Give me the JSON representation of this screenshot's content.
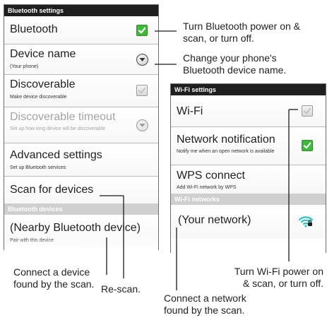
{
  "bluetooth_panel": {
    "header": "Bluetooth settings",
    "items": [
      {
        "title": "Bluetooth",
        "control": "checkbox-checked"
      },
      {
        "title": "Device name",
        "subtitle": "(Your phone)",
        "control": "round-button"
      },
      {
        "title": "Discoverable",
        "subtitle": "Make device discoverable",
        "control": "checkbox-unchecked"
      },
      {
        "title": "Discoverable timeout",
        "subtitle": "Set up how long device will be discoverable",
        "disabled": true,
        "control": "round-button"
      },
      {
        "title": "Advanced settings",
        "subtitle": "Set up Bluetooth services"
      },
      {
        "title": "Scan for devices"
      }
    ],
    "devices_header": "Bluetooth devices",
    "device": {
      "title": "(Nearby Bluetooth device)",
      "subtitle": "Pair with this device"
    }
  },
  "wifi_panel": {
    "header": "Wi-Fi settings",
    "items": [
      {
        "title": "Wi-Fi",
        "control": "checkbox-unchecked"
      },
      {
        "title": "Network notification",
        "subtitle": "Notify me when an open network is available",
        "control": "checkbox-checked"
      },
      {
        "title": "WPS connect",
        "subtitle": "Add Wi-Fi network by WPS"
      }
    ],
    "networks_header": "Wi-Fi networks",
    "network": {
      "title": "(Your network)",
      "icon": "wifi-signal-secured-icon"
    }
  },
  "callouts": {
    "bt_power": [
      "Turn Bluetooth power on &",
      "scan, or turn off."
    ],
    "device_name": [
      "Change your phone's",
      "Bluetooth device name."
    ],
    "connect_device": [
      "Connect a device",
      "found by the scan."
    ],
    "rescan": "Re-scan.",
    "connect_network": [
      "Connect a network",
      "found by the scan."
    ],
    "wifi_power": [
      "Turn Wi-Fi power on",
      "& scan, or turn off."
    ]
  },
  "colors": {
    "header_bg": "#1f1f1f",
    "category_bg": "#cfcfcf",
    "checkbox_on": "#3fb93a",
    "wifi_icon": "#2ec0c6"
  }
}
